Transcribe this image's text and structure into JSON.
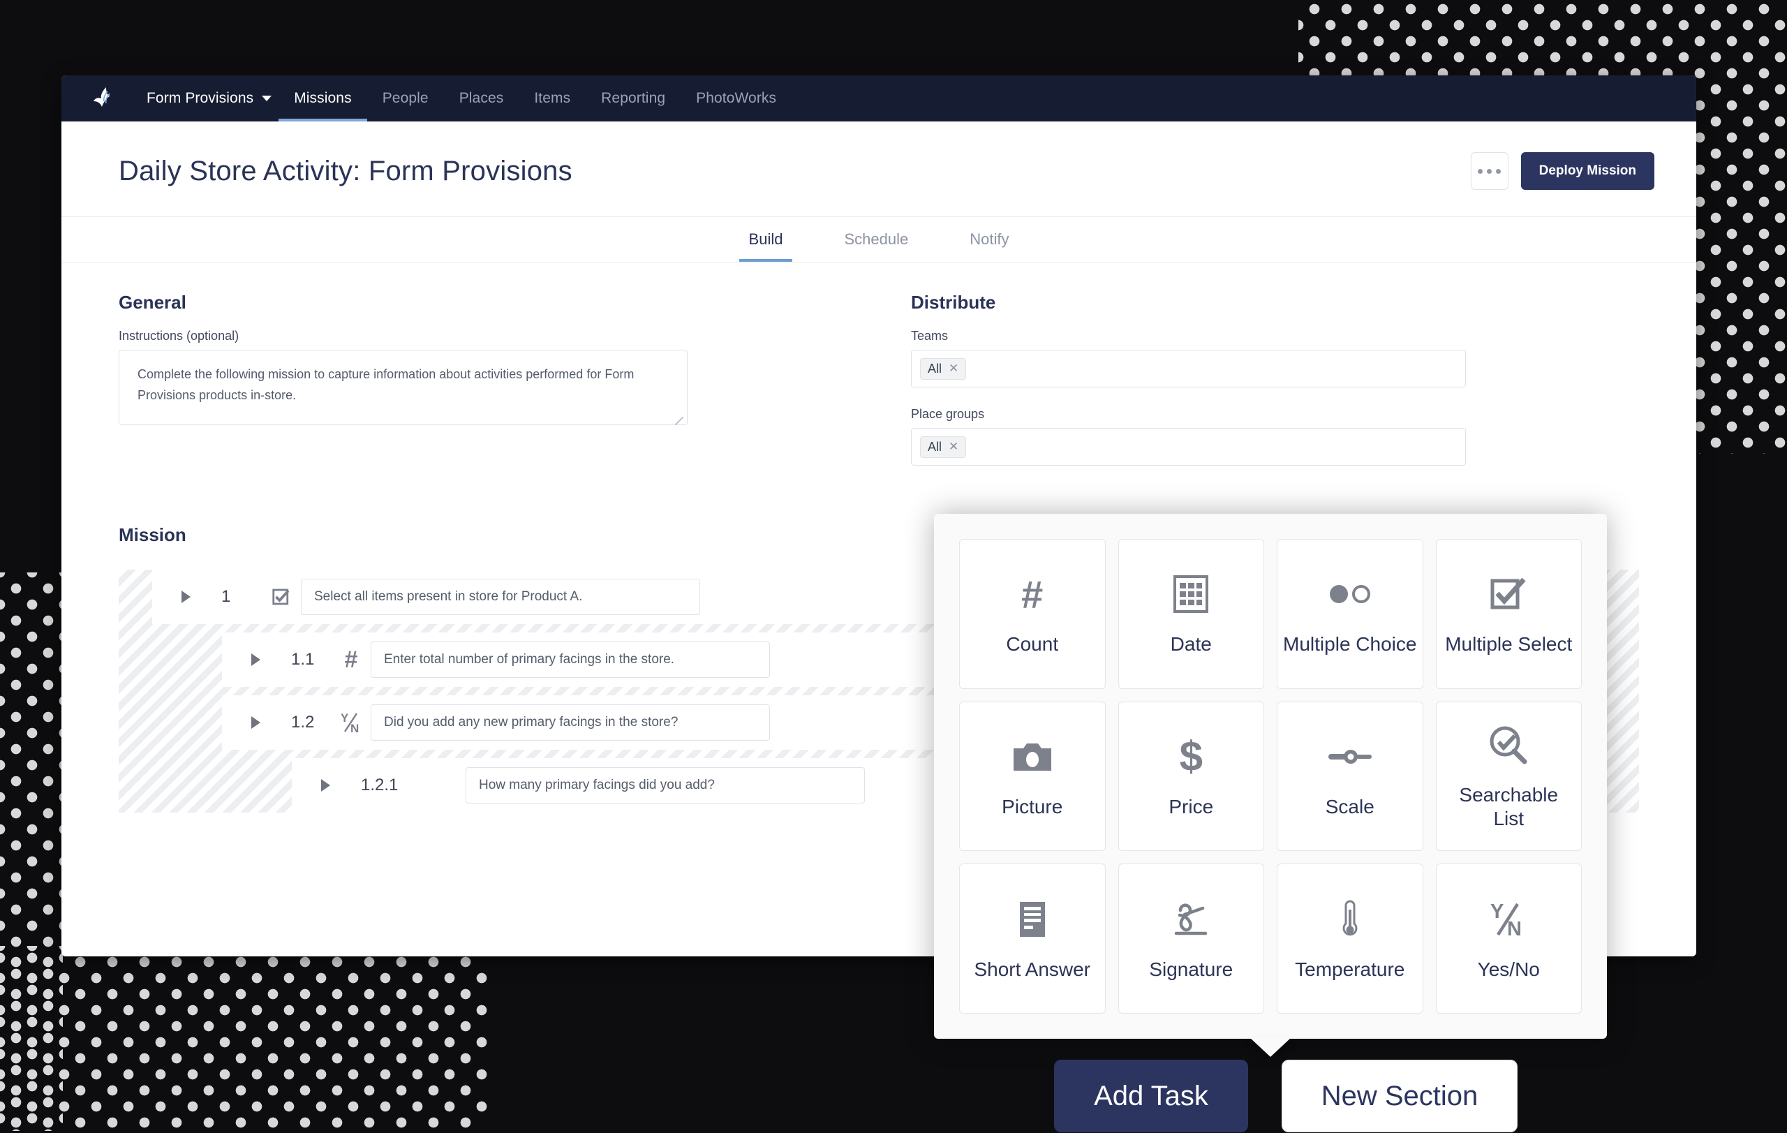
{
  "navbar": {
    "logo_icon": "bowtie-logo-icon",
    "brand": "Form Provisions",
    "items": [
      {
        "label": "Missions",
        "active": true
      },
      {
        "label": "People",
        "active": false
      },
      {
        "label": "Places",
        "active": false
      },
      {
        "label": "Items",
        "active": false
      },
      {
        "label": "Reporting",
        "active": false
      },
      {
        "label": "PhotoWorks",
        "active": false
      }
    ]
  },
  "header": {
    "title": "Daily Store Activity: Form Provisions",
    "more_icon": "ellipsis-icon",
    "deploy_label": "Deploy Mission"
  },
  "tabs": [
    {
      "label": "Build",
      "active": true
    },
    {
      "label": "Schedule",
      "active": false
    },
    {
      "label": "Notify",
      "active": false
    }
  ],
  "general": {
    "heading": "General",
    "instructions_label": "Instructions (optional)",
    "instructions_value": "Complete the following mission to capture information about activities performed for Form Provisions products in-store.",
    "instructions_placeholder": "Instructions (optional)"
  },
  "distribute": {
    "heading": "Distribute",
    "teams_label": "Teams",
    "teams_token": "All",
    "place_groups_label": "Place groups",
    "place_groups_token": "All",
    "remove_icon": "close-x-icon"
  },
  "mission": {
    "heading": "Mission",
    "tasks": [
      {
        "number": "1",
        "icon": "multiple-select-icon",
        "text": "Select all items present in store for Product A.",
        "level": 1
      },
      {
        "number": "1.1",
        "icon": "count-hash-icon",
        "text": "Enter total number of primary facings in the store.",
        "level": 2
      },
      {
        "number": "1.2",
        "icon": "yes-no-icon",
        "text": "Did you add any new primary facings in the store?",
        "level": 2
      },
      {
        "number": "1.2.1",
        "icon": "none",
        "text": "How many primary facings did you add?",
        "level": 3
      }
    ]
  },
  "task_picker": {
    "tiles": [
      {
        "label": "Count",
        "icon": "hash-icon"
      },
      {
        "label": "Date",
        "icon": "calendar-grid-icon"
      },
      {
        "label": "Multiple Choice",
        "icon": "radio-buttons-icon"
      },
      {
        "label": "Multiple Select",
        "icon": "checkbox-checked-icon"
      },
      {
        "label": "Picture",
        "icon": "camera-icon"
      },
      {
        "label": "Price",
        "icon": "dollar-sign-icon"
      },
      {
        "label": "Scale",
        "icon": "slider-scale-icon"
      },
      {
        "label": "Searchable List",
        "icon": "magnifier-check-icon"
      },
      {
        "label": "Short Answer",
        "icon": "text-lines-icon"
      },
      {
        "label": "Signature",
        "icon": "signature-pen-icon"
      },
      {
        "label": "Temperature",
        "icon": "thermometer-icon"
      },
      {
        "label": "Yes/No",
        "icon": "yes-no-icon"
      }
    ]
  },
  "footer_buttons": {
    "add_task": "Add Task",
    "new_section": "New Section"
  },
  "colors": {
    "navy": "#2b3560",
    "navbar": "#161d33",
    "accent_underline": "#7fa9d9",
    "page_bg": "#0d0d0f"
  }
}
